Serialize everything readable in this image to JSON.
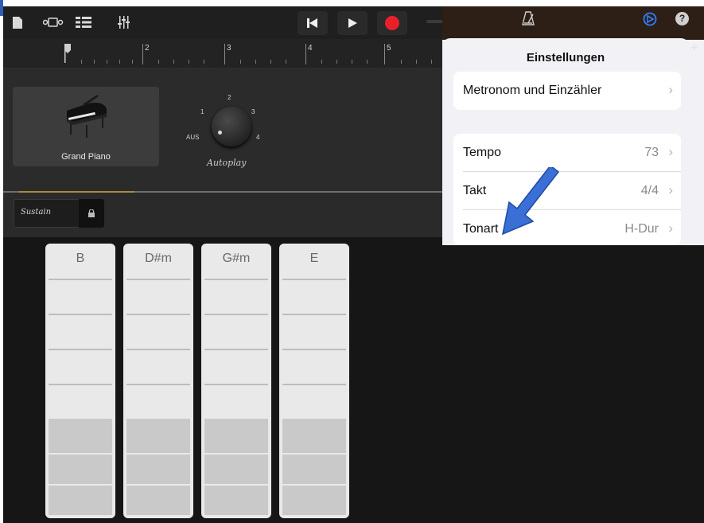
{
  "toolbar": {
    "icons": [
      "document-icon",
      "tracks-view-icon",
      "list-view-icon",
      "mixer-icon"
    ],
    "transport": [
      "rewind-icon",
      "play-icon",
      "record-icon"
    ],
    "right_icons": [
      "metronome-icon",
      "settings-icon",
      "help-icon"
    ],
    "record_color": "#e8202a",
    "settings_color": "#2f7ef7"
  },
  "ruler": {
    "marks": [
      "2",
      "3",
      "4",
      "5"
    ],
    "plus": "+"
  },
  "instrument": {
    "name": "Grand Piano",
    "knob_labels": {
      "top": "2",
      "left": "1",
      "right": "3",
      "off": "AUS",
      "max": "4"
    },
    "knob_caption": "Autoplay"
  },
  "sustain": {
    "label": "Sustain"
  },
  "chords": [
    "B",
    "D#m",
    "G#m",
    "E"
  ],
  "settings": {
    "title": "Einstellungen",
    "metronome": "Metronom und Einzähler",
    "rows": [
      {
        "label": "Tempo",
        "value": "73"
      },
      {
        "label": "Takt",
        "value": "4/4"
      },
      {
        "label": "Tonart",
        "value": "H-Dur"
      }
    ],
    "arrow_color": "#3a6fd6"
  }
}
